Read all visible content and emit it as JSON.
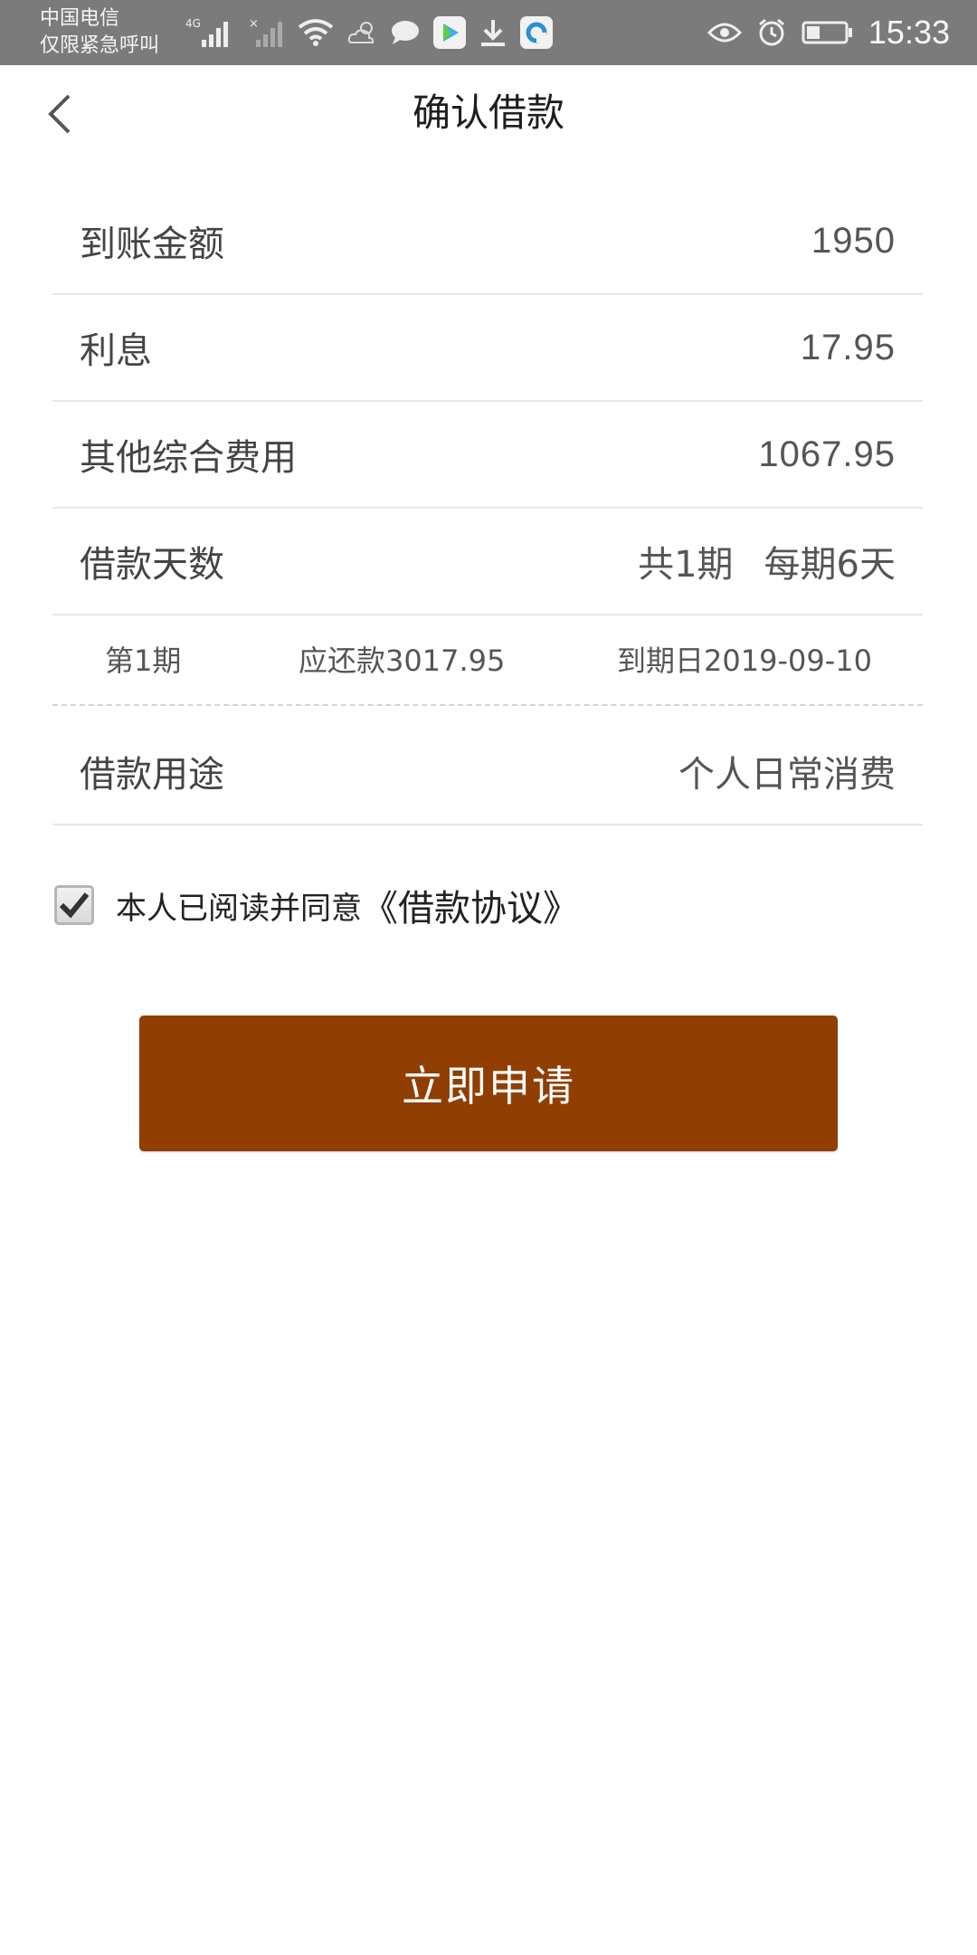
{
  "status_bar": {
    "carrier_line1": "中国电信",
    "carrier_line2": "仅限紧急呼叫",
    "time": "15:33",
    "network": "4G",
    "icons_left": [
      "signal-icon",
      "no-signal-icon",
      "wifi-icon",
      "weather-icon",
      "message-icon",
      "video-app-icon",
      "download-icon",
      "browser-app-icon"
    ],
    "icons_right": [
      "eye-icon",
      "alarm-icon",
      "battery-icon"
    ]
  },
  "header": {
    "title": "确认借款",
    "back_icon": "chevron-left-icon"
  },
  "details": [
    {
      "label": "到账金额",
      "value": "1950"
    },
    {
      "label": "利息",
      "value": "17.95"
    },
    {
      "label": "其他综合费用",
      "value": "1067.95"
    }
  ],
  "loan_days": {
    "label": "借款天数",
    "periods": "共1期",
    "per_period": "每期6天"
  },
  "schedule": {
    "period": "第1期",
    "amount_due": "应还款3017.95",
    "due_date": "到期日2019-09-10"
  },
  "purpose": {
    "label": "借款用途",
    "value": "个人日常消费"
  },
  "agreement": {
    "checked": true,
    "text": "本人已阅读并同意",
    "link": "《借款协议》"
  },
  "apply_button": {
    "label": "立即申请",
    "color": "#903e02"
  }
}
